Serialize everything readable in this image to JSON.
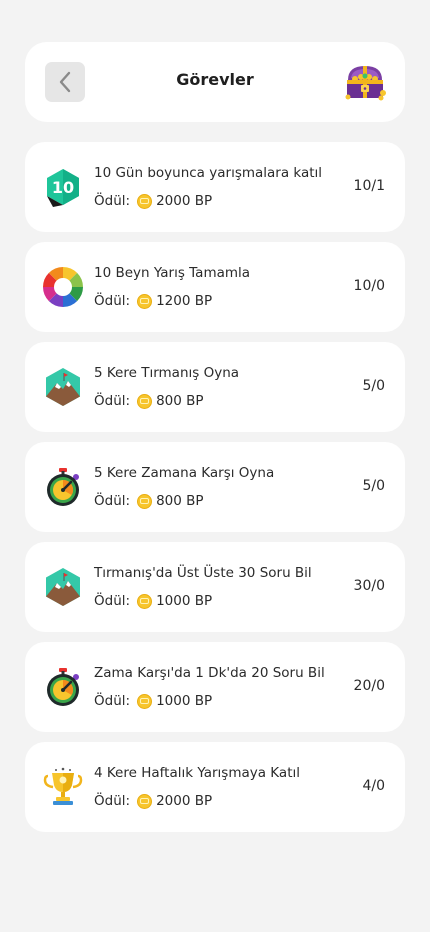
{
  "header": {
    "title": "Görevler",
    "back_icon": "chevron-left-icon",
    "chest_icon": "treasure-chest-icon"
  },
  "reward_label": "Ödül:",
  "tasks": [
    {
      "icon": "number-10-badge-icon",
      "title": "10 Gün boyunca yarışmalara katıl",
      "reward": "2000 BP",
      "progress": "10/1"
    },
    {
      "icon": "color-wheel-icon",
      "title": "10 Beyn Yarış Tamamla",
      "reward": "1200 BP",
      "progress": "10/0"
    },
    {
      "icon": "mountain-icon",
      "title": "5 Kere Tırmanış Oyna",
      "reward": "800 BP",
      "progress": "5/0"
    },
    {
      "icon": "stopwatch-icon",
      "title": "5 Kere Zamana Karşı Oyna",
      "reward": "800 BP",
      "progress": "5/0"
    },
    {
      "icon": "mountain-icon",
      "title": "Tırmanış'da Üst Üste 30 Soru Bil",
      "reward": "1000 BP",
      "progress": "30/0"
    },
    {
      "icon": "stopwatch-icon",
      "title": "Zama Karşı'da 1 Dk'da 20 Soru Bil",
      "reward": "1000 BP",
      "progress": "20/0"
    },
    {
      "icon": "trophy-icon",
      "title": "4 Kere Haftalık Yarışmaya Katıl",
      "reward": "2000 BP",
      "progress": "4/0"
    }
  ]
}
